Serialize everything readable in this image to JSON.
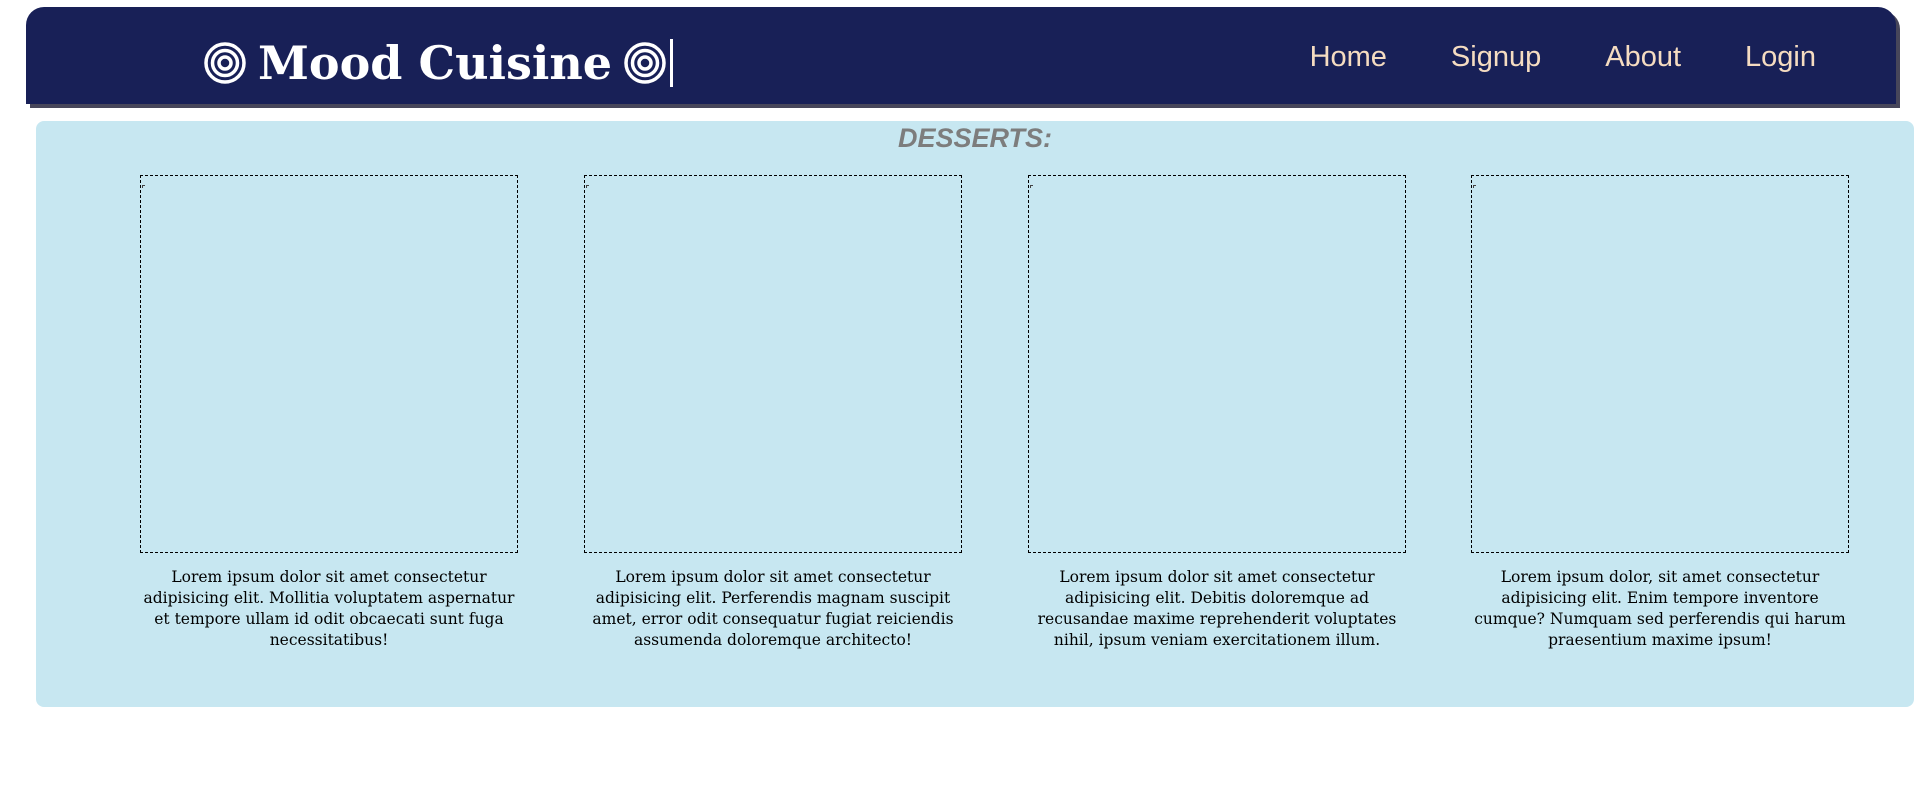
{
  "header": {
    "brand_icon_left": "target-icon",
    "brand_title": "Mood Cuisine",
    "brand_icon_right": "target-icon",
    "nav": [
      {
        "label": "Home"
      },
      {
        "label": "Signup"
      },
      {
        "label": "About"
      },
      {
        "label": "Login"
      }
    ],
    "colors": {
      "navbar_bg": "#182057",
      "nav_link": "#f5dcc1"
    }
  },
  "main": {
    "section_title": "DESSERTS:",
    "background": "#c7e7f1",
    "cards": [
      {
        "text": "Lorem ipsum dolor sit amet consectetur adipisicing elit. Mollitia voluptatem aspernatur et tempore ullam id odit obcaecati sunt fuga necessitatibus!"
      },
      {
        "text": "Lorem ipsum dolor sit amet consectetur adipisicing elit. Perferendis magnam suscipit amet, error odit consequatur fugiat reiciendis assumenda doloremque architecto!"
      },
      {
        "text": "Lorem ipsum dolor sit amet consectetur adipisicing elit. Debitis doloremque ad recusandae maxime reprehenderit voluptates nihil, ipsum veniam exercitationem illum."
      },
      {
        "text": "Lorem ipsum dolor, sit amet consectetur adipisicing elit. Enim tempore inventore cumque? Numquam sed perferendis qui harum praesentium maxime ipsum!"
      }
    ]
  }
}
